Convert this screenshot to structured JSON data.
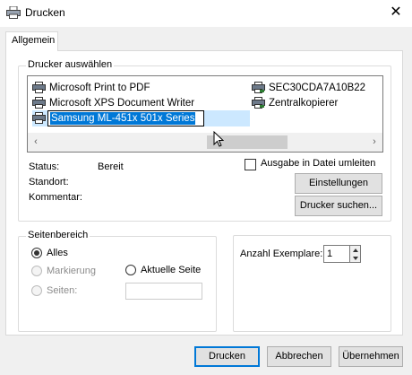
{
  "window": {
    "title": "Drucken",
    "close_glyph": "✕"
  },
  "tabs": [
    {
      "label": "Allgemein"
    }
  ],
  "printer_group": {
    "label": "Drucker auswählen",
    "printers": [
      {
        "name": "Microsoft Print to PDF",
        "icon": "printer-icon"
      },
      {
        "name": "Microsoft XPS Document Writer",
        "icon": "printer-icon"
      },
      {
        "name": "Samsung ML-451x 501x Series",
        "icon": "printer-icon",
        "editing": true
      },
      {
        "name": "SEC30CDA7A10B22",
        "icon": "printer-icon"
      },
      {
        "name": "Zentralkopierer",
        "icon": "printer-icon"
      }
    ],
    "status_label": "Status:",
    "status_value": "Bereit",
    "location_label": "Standort:",
    "comment_label": "Kommentar:",
    "print_to_file": {
      "label": "Ausgabe in Datei umleiten",
      "checked": false
    },
    "settings_button": "Einstellungen",
    "find_printer_button": "Drucker suchen...",
    "scroll_left_glyph": "‹",
    "scroll_right_glyph": "›"
  },
  "page_range": {
    "label": "Seitenbereich",
    "all": "Alles",
    "selection": "Markierung",
    "current_page": "Aktuelle Seite",
    "pages": "Seiten:",
    "selected": "all"
  },
  "copies": {
    "label": "Anzahl Exemplare:",
    "value": "1"
  },
  "footer": {
    "print_button": "Drucken",
    "cancel_button": "Abbrechen",
    "apply_button": "Übernehmen"
  },
  "colors": {
    "selection_blue": "#0078d7",
    "highlight_row": "#cce8ff",
    "accent_border": "#0078d7"
  }
}
